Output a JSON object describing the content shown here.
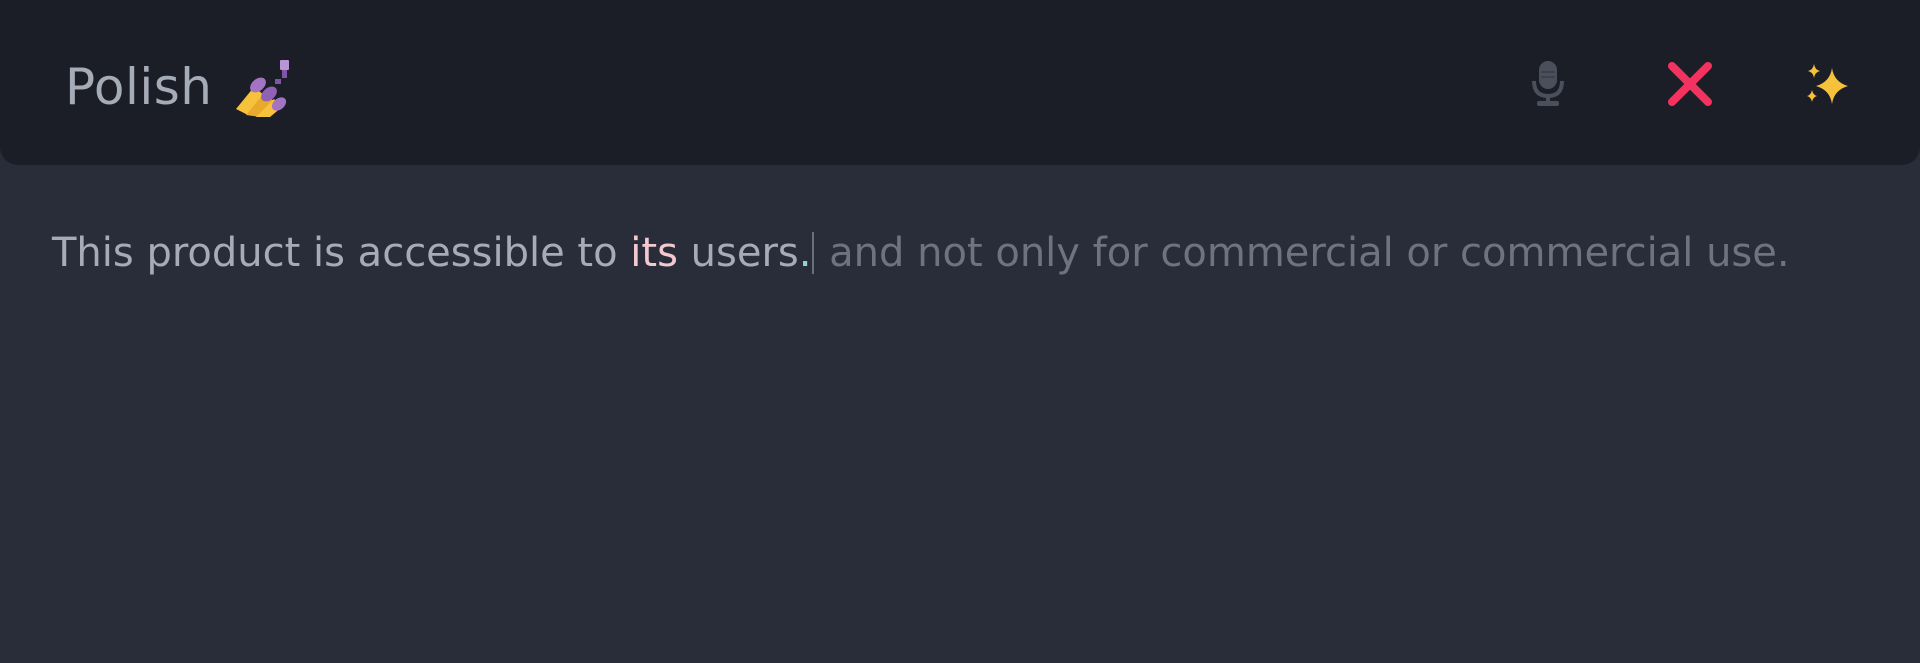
{
  "header": {
    "title": "Polish",
    "title_icon": "nail-polish-icon"
  },
  "toolbar": {
    "mic_icon": "microphone-icon",
    "close_icon": "close-icon",
    "sparkle_icon": "sparkles-icon"
  },
  "editor": {
    "text_part1": "This product is accessible to ",
    "text_highlight": "its",
    "text_part2": " users",
    "text_period": ".",
    "suggestion": " and not only for commercial or commercial use."
  },
  "colors": {
    "background": "#282d39",
    "header_background": "#1b1e26",
    "text": "#a6abb8",
    "suggestion_text": "#6e7381",
    "highlight_word": "#f3c9cf",
    "highlight_punct": "#8fd6cd",
    "close_icon": "#f2335f",
    "sparkle_icon": "#f7c23b",
    "mic_icon": "#4a4f5b"
  }
}
